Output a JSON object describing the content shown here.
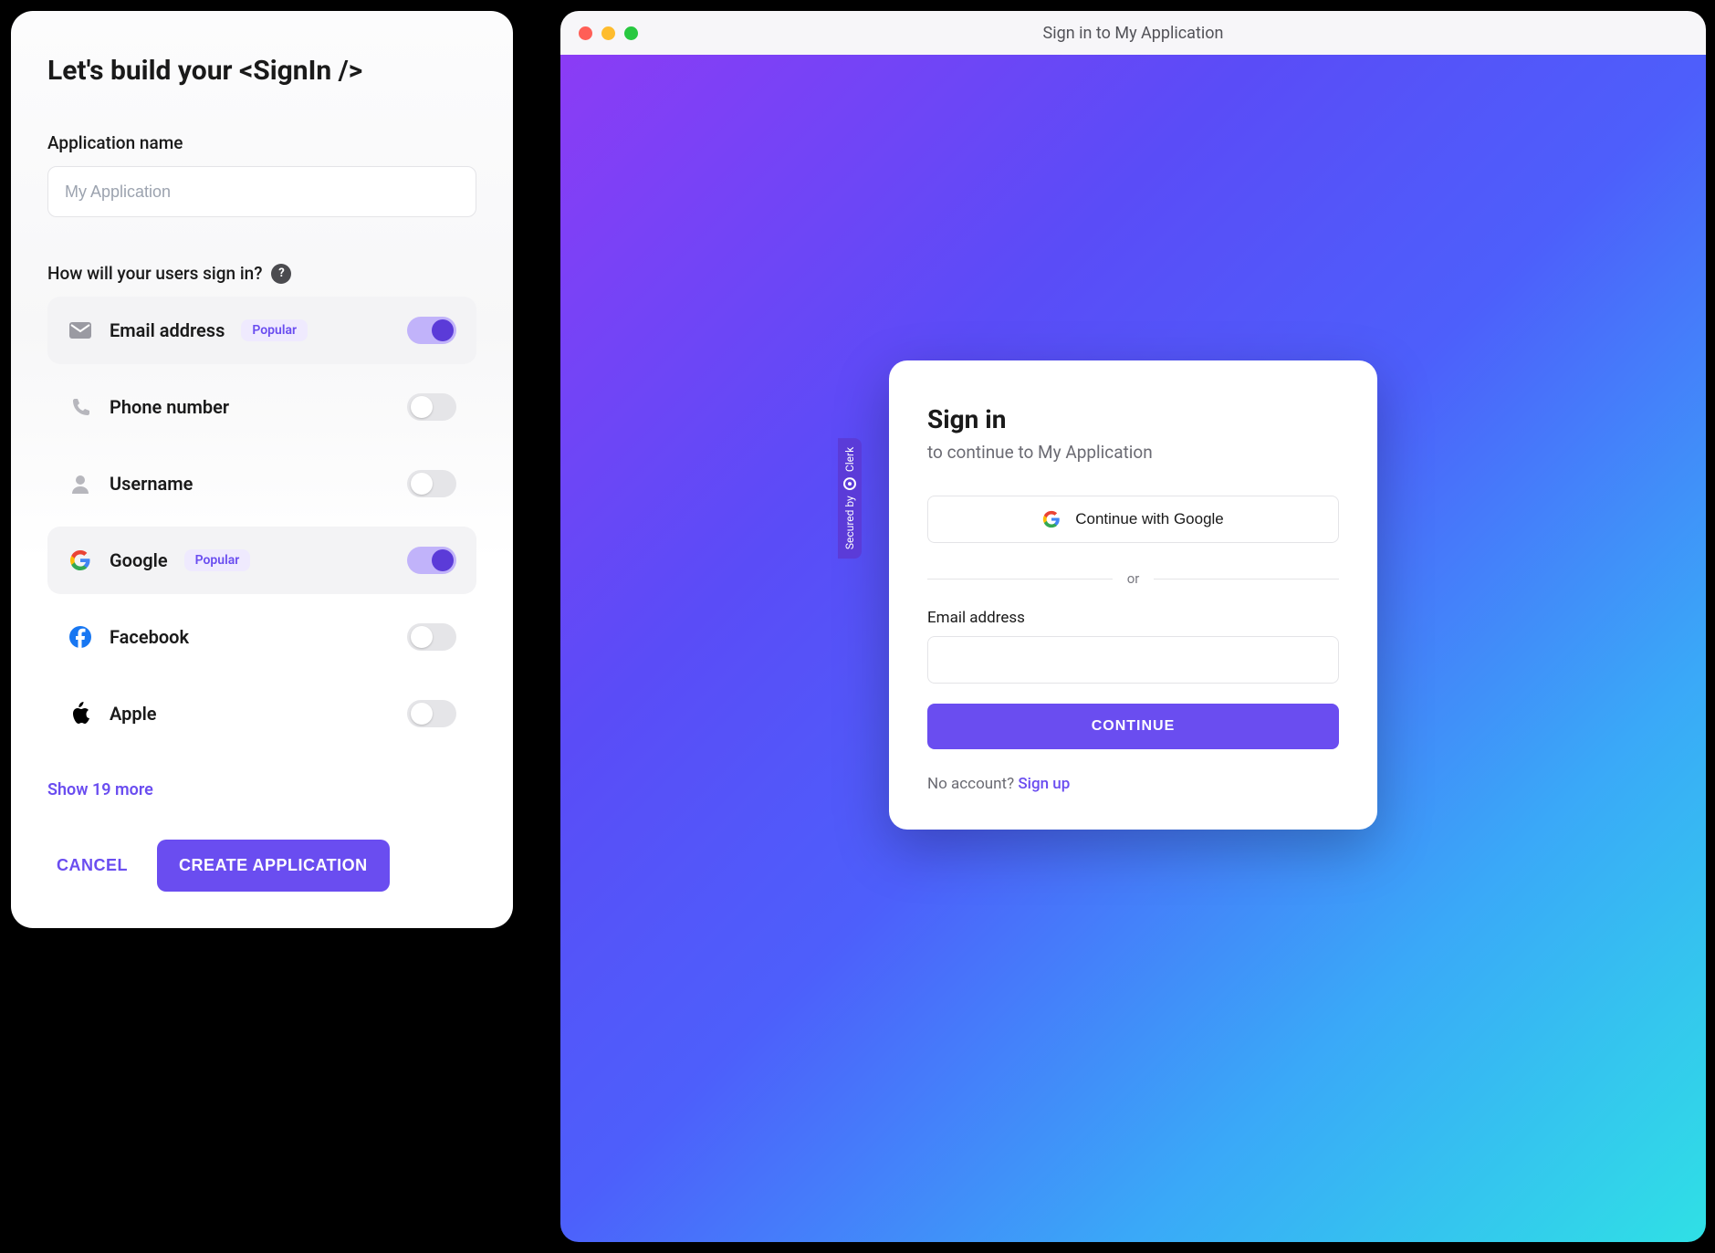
{
  "builder": {
    "title": "Let's build your <SignIn />",
    "app_name_label": "Application name",
    "app_name_placeholder": "My Application",
    "signin_label": "How will your users sign in?",
    "help_glyph": "?",
    "popular_badge": "Popular",
    "options": [
      {
        "key": "email",
        "label": "Email address",
        "popular": true,
        "enabled": true
      },
      {
        "key": "phone",
        "label": "Phone number",
        "popular": false,
        "enabled": false
      },
      {
        "key": "username",
        "label": "Username",
        "popular": false,
        "enabled": false
      },
      {
        "key": "google",
        "label": "Google",
        "popular": true,
        "enabled": true
      },
      {
        "key": "facebook",
        "label": "Facebook",
        "popular": false,
        "enabled": false
      },
      {
        "key": "apple",
        "label": "Apple",
        "popular": false,
        "enabled": false
      }
    ],
    "show_more": "Show 19 more",
    "cancel": "CANCEL",
    "create": "CREATE APPLICATION"
  },
  "preview": {
    "window_title": "Sign in to My Application",
    "secured_by": "Secured by",
    "secured_brand": "Clerk",
    "card": {
      "title": "Sign in",
      "subtitle": "to continue to My Application",
      "google_label": "Continue with Google",
      "or": "or",
      "email_label": "Email address",
      "continue": "CONTINUE",
      "no_account": "No account? ",
      "signup": "Sign up"
    }
  }
}
